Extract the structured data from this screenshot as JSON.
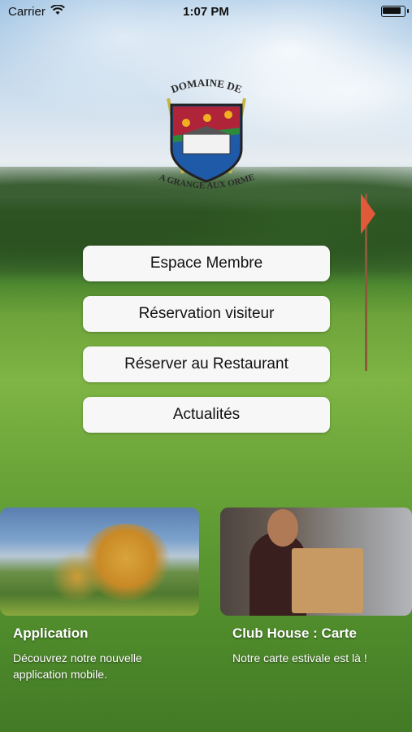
{
  "status_bar": {
    "carrier": "Carrier",
    "time": "1:07 PM",
    "wifi_icon": "wifi-icon",
    "battery_icon": "battery-icon"
  },
  "logo": {
    "line1": "DOMAINE DE",
    "line2": "LA GRANGE AUX ORMES"
  },
  "menu": {
    "items": [
      {
        "label": "Espace Membre"
      },
      {
        "label": "Réservation visiteur"
      },
      {
        "label": "Réserver au Restaurant"
      },
      {
        "label": "Actualités"
      }
    ]
  },
  "cards": [
    {
      "title": "Application",
      "text": "Découvrez notre nouvelle application mobile."
    },
    {
      "title": "Club House : Carte",
      "text": "Notre carte estivale est là !"
    }
  ],
  "colors": {
    "button_bg": "#f7f7f7",
    "flag": "#e05a3a",
    "shield_blue": "#1f5aa8",
    "shield_red": "#b0243a",
    "shield_green": "#2c8a3a"
  }
}
